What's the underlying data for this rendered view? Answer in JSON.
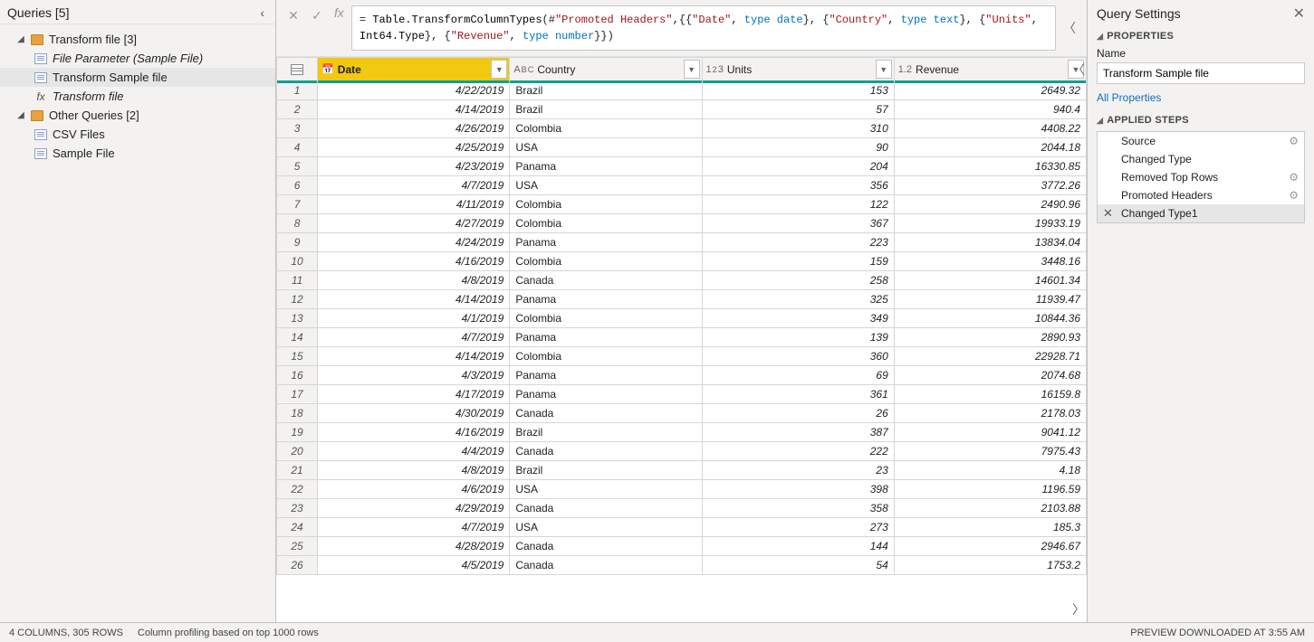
{
  "queries": {
    "title": "Queries [5]",
    "folder1": "Transform file [3]",
    "item_file_parameter": "File Parameter (Sample File)",
    "item_transform_sample": "Transform Sample file",
    "item_transform_file": "Transform file",
    "folder2": "Other Queries [2]",
    "item_csv": "CSV Files",
    "item_sample": "Sample File"
  },
  "formula": {
    "prefix": "= ",
    "func1": "Table.TransformColumnTypes",
    "open": "(#",
    "arg1": "\"Promoted Headers\"",
    "text2": ",{{",
    "s_date": "\"Date\"",
    "comma": ", ",
    "kw_type": "type",
    "kw_date": " date",
    "text3": "}, {",
    "s_country": "\"Country\"",
    "kw_text": " text",
    "s_units": "\"Units\"",
    "int64": "Int64.Type",
    "s_rev": "\"Revenue\"",
    "kw_num": " number",
    "close": "}})"
  },
  "columns": {
    "date": "Date",
    "country": "Country",
    "units": "Units",
    "revenue": "Revenue"
  },
  "rows": [
    {
      "n": 1,
      "date": "4/22/2019",
      "country": "Brazil",
      "units": 153,
      "rev": "2649.32"
    },
    {
      "n": 2,
      "date": "4/14/2019",
      "country": "Brazil",
      "units": 57,
      "rev": "940.4"
    },
    {
      "n": 3,
      "date": "4/26/2019",
      "country": "Colombia",
      "units": 310,
      "rev": "4408.22"
    },
    {
      "n": 4,
      "date": "4/25/2019",
      "country": "USA",
      "units": 90,
      "rev": "2044.18"
    },
    {
      "n": 5,
      "date": "4/23/2019",
      "country": "Panama",
      "units": 204,
      "rev": "16330.85"
    },
    {
      "n": 6,
      "date": "4/7/2019",
      "country": "USA",
      "units": 356,
      "rev": "3772.26"
    },
    {
      "n": 7,
      "date": "4/11/2019",
      "country": "Colombia",
      "units": 122,
      "rev": "2490.96"
    },
    {
      "n": 8,
      "date": "4/27/2019",
      "country": "Colombia",
      "units": 367,
      "rev": "19933.19"
    },
    {
      "n": 9,
      "date": "4/24/2019",
      "country": "Panama",
      "units": 223,
      "rev": "13834.04"
    },
    {
      "n": 10,
      "date": "4/16/2019",
      "country": "Colombia",
      "units": 159,
      "rev": "3448.16"
    },
    {
      "n": 11,
      "date": "4/8/2019",
      "country": "Canada",
      "units": 258,
      "rev": "14601.34"
    },
    {
      "n": 12,
      "date": "4/14/2019",
      "country": "Panama",
      "units": 325,
      "rev": "11939.47"
    },
    {
      "n": 13,
      "date": "4/1/2019",
      "country": "Colombia",
      "units": 349,
      "rev": "10844.36"
    },
    {
      "n": 14,
      "date": "4/7/2019",
      "country": "Panama",
      "units": 139,
      "rev": "2890.93"
    },
    {
      "n": 15,
      "date": "4/14/2019",
      "country": "Colombia",
      "units": 360,
      "rev": "22928.71"
    },
    {
      "n": 16,
      "date": "4/3/2019",
      "country": "Panama",
      "units": 69,
      "rev": "2074.68"
    },
    {
      "n": 17,
      "date": "4/17/2019",
      "country": "Panama",
      "units": 361,
      "rev": "16159.8"
    },
    {
      "n": 18,
      "date": "4/30/2019",
      "country": "Canada",
      "units": 26,
      "rev": "2178.03"
    },
    {
      "n": 19,
      "date": "4/16/2019",
      "country": "Brazil",
      "units": 387,
      "rev": "9041.12"
    },
    {
      "n": 20,
      "date": "4/4/2019",
      "country": "Canada",
      "units": 222,
      "rev": "7975.43"
    },
    {
      "n": 21,
      "date": "4/8/2019",
      "country": "Brazil",
      "units": 23,
      "rev": "4.18"
    },
    {
      "n": 22,
      "date": "4/6/2019",
      "country": "USA",
      "units": 398,
      "rev": "1196.59"
    },
    {
      "n": 23,
      "date": "4/29/2019",
      "country": "Canada",
      "units": 358,
      "rev": "2103.88"
    },
    {
      "n": 24,
      "date": "4/7/2019",
      "country": "USA",
      "units": 273,
      "rev": "185.3"
    },
    {
      "n": 25,
      "date": "4/28/2019",
      "country": "Canada",
      "units": 144,
      "rev": "2946.67"
    },
    {
      "n": 26,
      "date": "4/5/2019",
      "country": "Canada",
      "units": 54,
      "rev": "1753.2"
    }
  ],
  "settings": {
    "title": "Query Settings",
    "properties": "PROPERTIES",
    "name_label": "Name",
    "name_value": "Transform Sample file",
    "all_props": "All Properties",
    "applied_steps": "APPLIED STEPS",
    "steps": [
      {
        "label": "Source",
        "gear": true
      },
      {
        "label": "Changed Type",
        "gear": false
      },
      {
        "label": "Removed Top Rows",
        "gear": true
      },
      {
        "label": "Promoted Headers",
        "gear": true
      },
      {
        "label": "Changed Type1",
        "gear": false,
        "selected": true
      }
    ]
  },
  "status": {
    "cols_rows": "4 COLUMNS, 305 ROWS",
    "profiling": "Column profiling based on top 1000 rows",
    "preview": "PREVIEW DOWNLOADED AT 3:55 AM"
  }
}
